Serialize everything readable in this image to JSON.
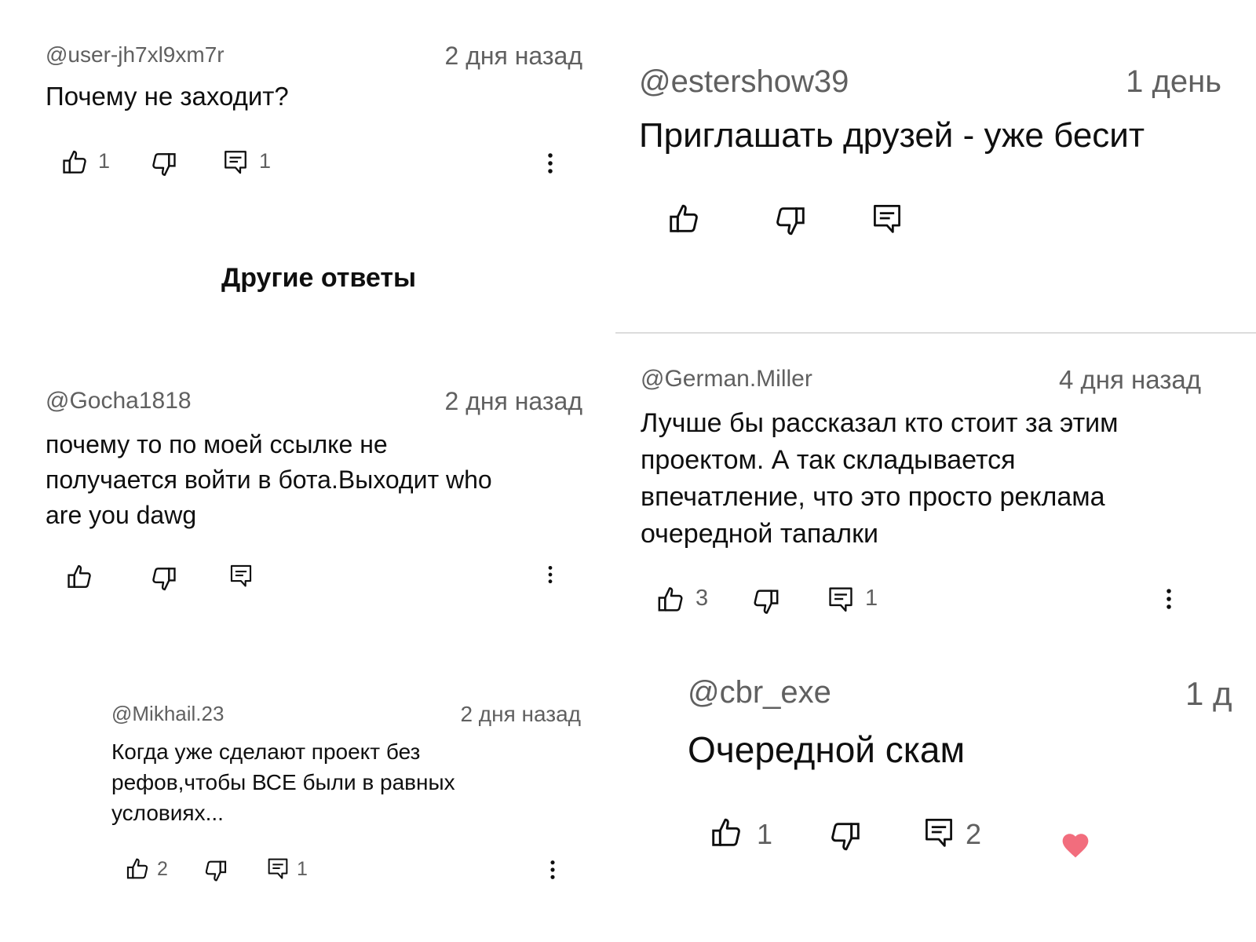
{
  "colors": {
    "text": "#0f0f0f",
    "secondary": "#606060",
    "heart": "#f26d7d",
    "divider": "#dcdcdc"
  },
  "c1": {
    "author": "@user-jh7xl9xm7r",
    "time": "2 дня назад",
    "text": "Почему не заходит?",
    "likes": "1",
    "replies": "1"
  },
  "other_replies": {
    "label": "Другие ответы"
  },
  "c2": {
    "author": "@Gocha1818",
    "time": "2 дня назад",
    "lines": [
      "почему то по моей  ссылке не",
      "получается войти в бота.Выходит who",
      "are you dawg"
    ]
  },
  "c3": {
    "author": "@Mikhail.23",
    "time": "2 дня назад",
    "lines": [
      "Когда уже сделают проект без",
      "рефов,чтобы ВСЕ были в равных",
      "условиях..."
    ],
    "likes": "2",
    "replies": "1"
  },
  "c4": {
    "author": "@estershow39",
    "time": "1 день",
    "text": "Приглашать друзей - уже бесит"
  },
  "c5": {
    "author": "@German.Miller",
    "time": "4 дня назад",
    "lines": [
      "Лучше бы рассказал кто стоит за этим",
      "проектом. А так складывается",
      "впечатление, что это просто реклама",
      "очередной тапалки"
    ],
    "likes": "3",
    "replies": "1"
  },
  "c6": {
    "author": "@cbr_exe",
    "time": "1 д",
    "text": "Очередной скам",
    "likes": "1",
    "replies": "2"
  },
  "icons": {
    "like": "thumbs-up-icon",
    "dislike": "thumbs-down-icon",
    "reply": "comment-icon",
    "more": "more-vertical-icon",
    "heart": "heart-icon"
  }
}
